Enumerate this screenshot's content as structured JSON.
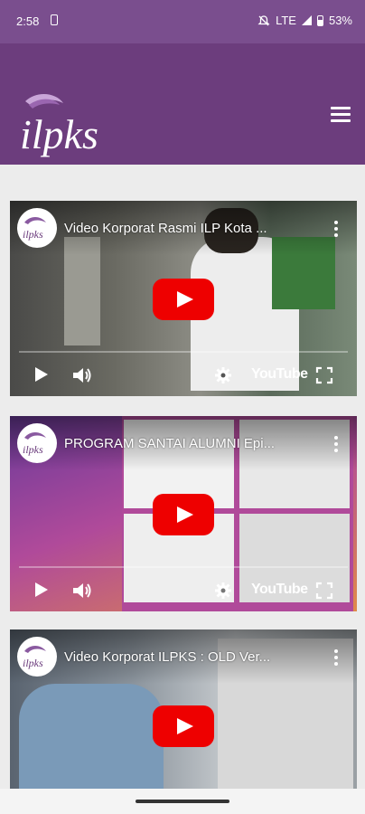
{
  "status_bar": {
    "time": "2:58",
    "network": "LTE",
    "battery": "53%"
  },
  "header": {
    "logo_text": "ilpks",
    "brand_color": "#6c3d7d"
  },
  "videos": [
    {
      "title": "Video Korporat Rasmi ILP Kota ...",
      "youtube_label": "YouTube"
    },
    {
      "title": "PROGRAM SANTAI ALUMNI Epi...",
      "youtube_label": "YouTube"
    },
    {
      "title": "Video Korporat ILPKS : OLD Ver..."
    }
  ]
}
